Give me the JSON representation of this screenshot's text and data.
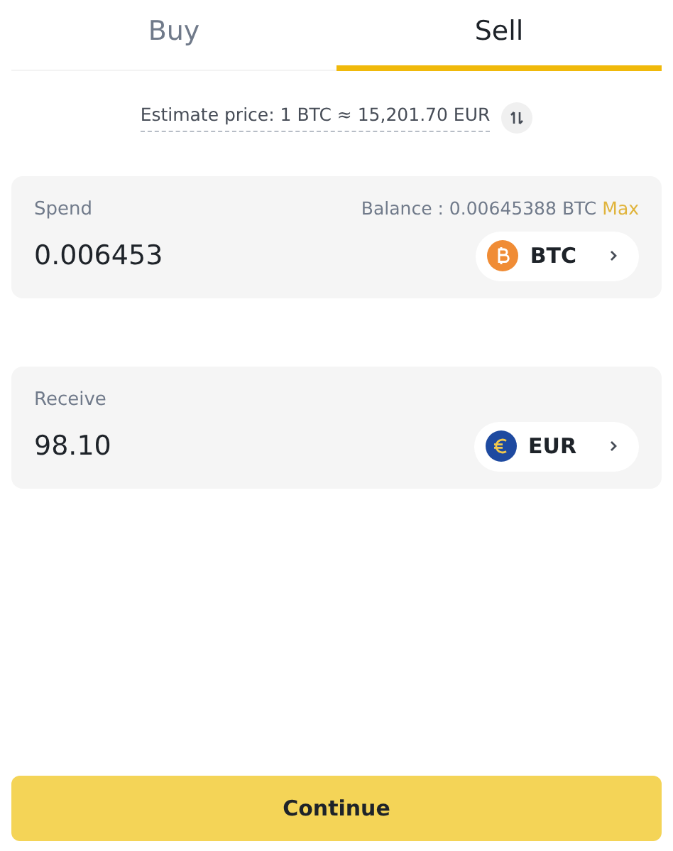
{
  "tabs": [
    {
      "label": "Buy",
      "selected": false
    },
    {
      "label": "Sell",
      "selected": true
    }
  ],
  "estimate": {
    "text": "Estimate price: 1 BTC ≈ 15,201.70 EUR"
  },
  "cards": [
    {
      "label": "Spend",
      "balance": "Balance : 0.00645388 BTC",
      "max": "Max",
      "value": "0.006453",
      "currency": {
        "kind": "btc",
        "code": "BTC"
      }
    },
    {
      "label": "Receive",
      "value": "98.10",
      "currency": {
        "kind": "eur",
        "code": "EUR"
      }
    }
  ],
  "button": "Continue"
}
